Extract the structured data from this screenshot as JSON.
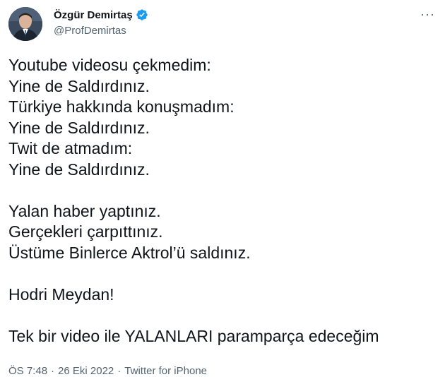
{
  "author": {
    "display_name": "Özgür Demirtaş",
    "handle": "@ProfDemirtas",
    "verified": true,
    "verified_color": "#1d9bf0"
  },
  "icons": {
    "verified": "verified-badge-icon",
    "more": "more-options-icon"
  },
  "more_label": "···",
  "tweet": {
    "lines": [
      "Youtube videosu çekmedim:",
      "Yine de Saldırdınız.",
      "Türkiye hakkında konuşmadım:",
      "Yine de Saldırdınız.",
      "Twit de atmadım:",
      "Yine de Saldırdınız.",
      "",
      "Yalan haber yaptınız.",
      "Gerçekleri çarpıttınız.",
      "Üstüme Binlerce Aktrol’ü saldınız.",
      "",
      "Hodri Meydan!",
      "",
      "Tek bir video ile YALANLARI paramparça edeceğim"
    ]
  },
  "meta": {
    "time": "ÖS 7:48",
    "separator": "·",
    "date": "26 Eki 2022",
    "source": "Twitter for iPhone"
  }
}
